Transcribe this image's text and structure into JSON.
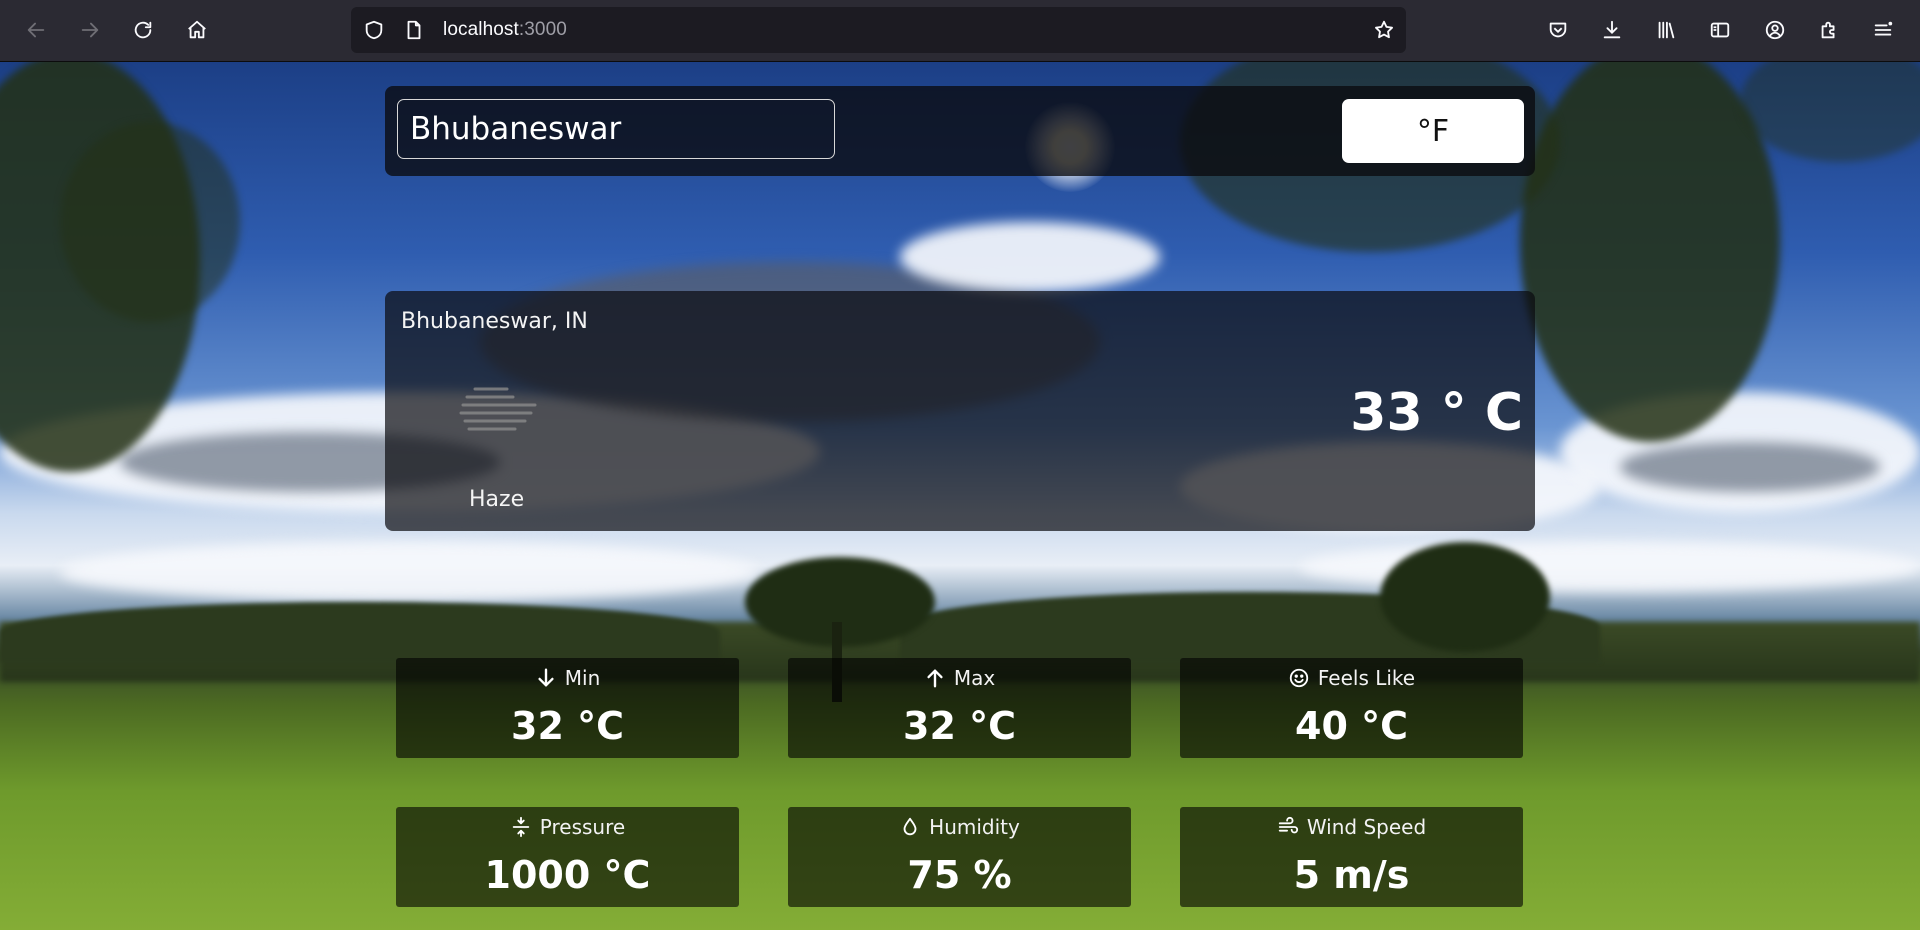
{
  "browser": {
    "url_host": "localhost",
    "url_port": ":3000"
  },
  "search": {
    "city_value": "Bhubaneswar"
  },
  "unit_toggle": {
    "label": "°F"
  },
  "current": {
    "location": "Bhubaneswar, IN",
    "condition": "Haze",
    "temperature": "33 ° C"
  },
  "stats": [
    {
      "icon": "arrow-down-icon",
      "label": "Min",
      "value": "32 °C"
    },
    {
      "icon": "arrow-up-icon",
      "label": "Max",
      "value": "32 °C"
    },
    {
      "icon": "smile-icon",
      "label": "Feels Like",
      "value": "40 °C"
    },
    {
      "icon": "pressure-icon",
      "label": "Pressure",
      "value": "1000 °C"
    },
    {
      "icon": "droplet-icon",
      "label": "Humidity",
      "value": "75 %"
    },
    {
      "icon": "wind-icon",
      "label": "Wind Speed",
      "value": "5 m/s"
    }
  ]
}
